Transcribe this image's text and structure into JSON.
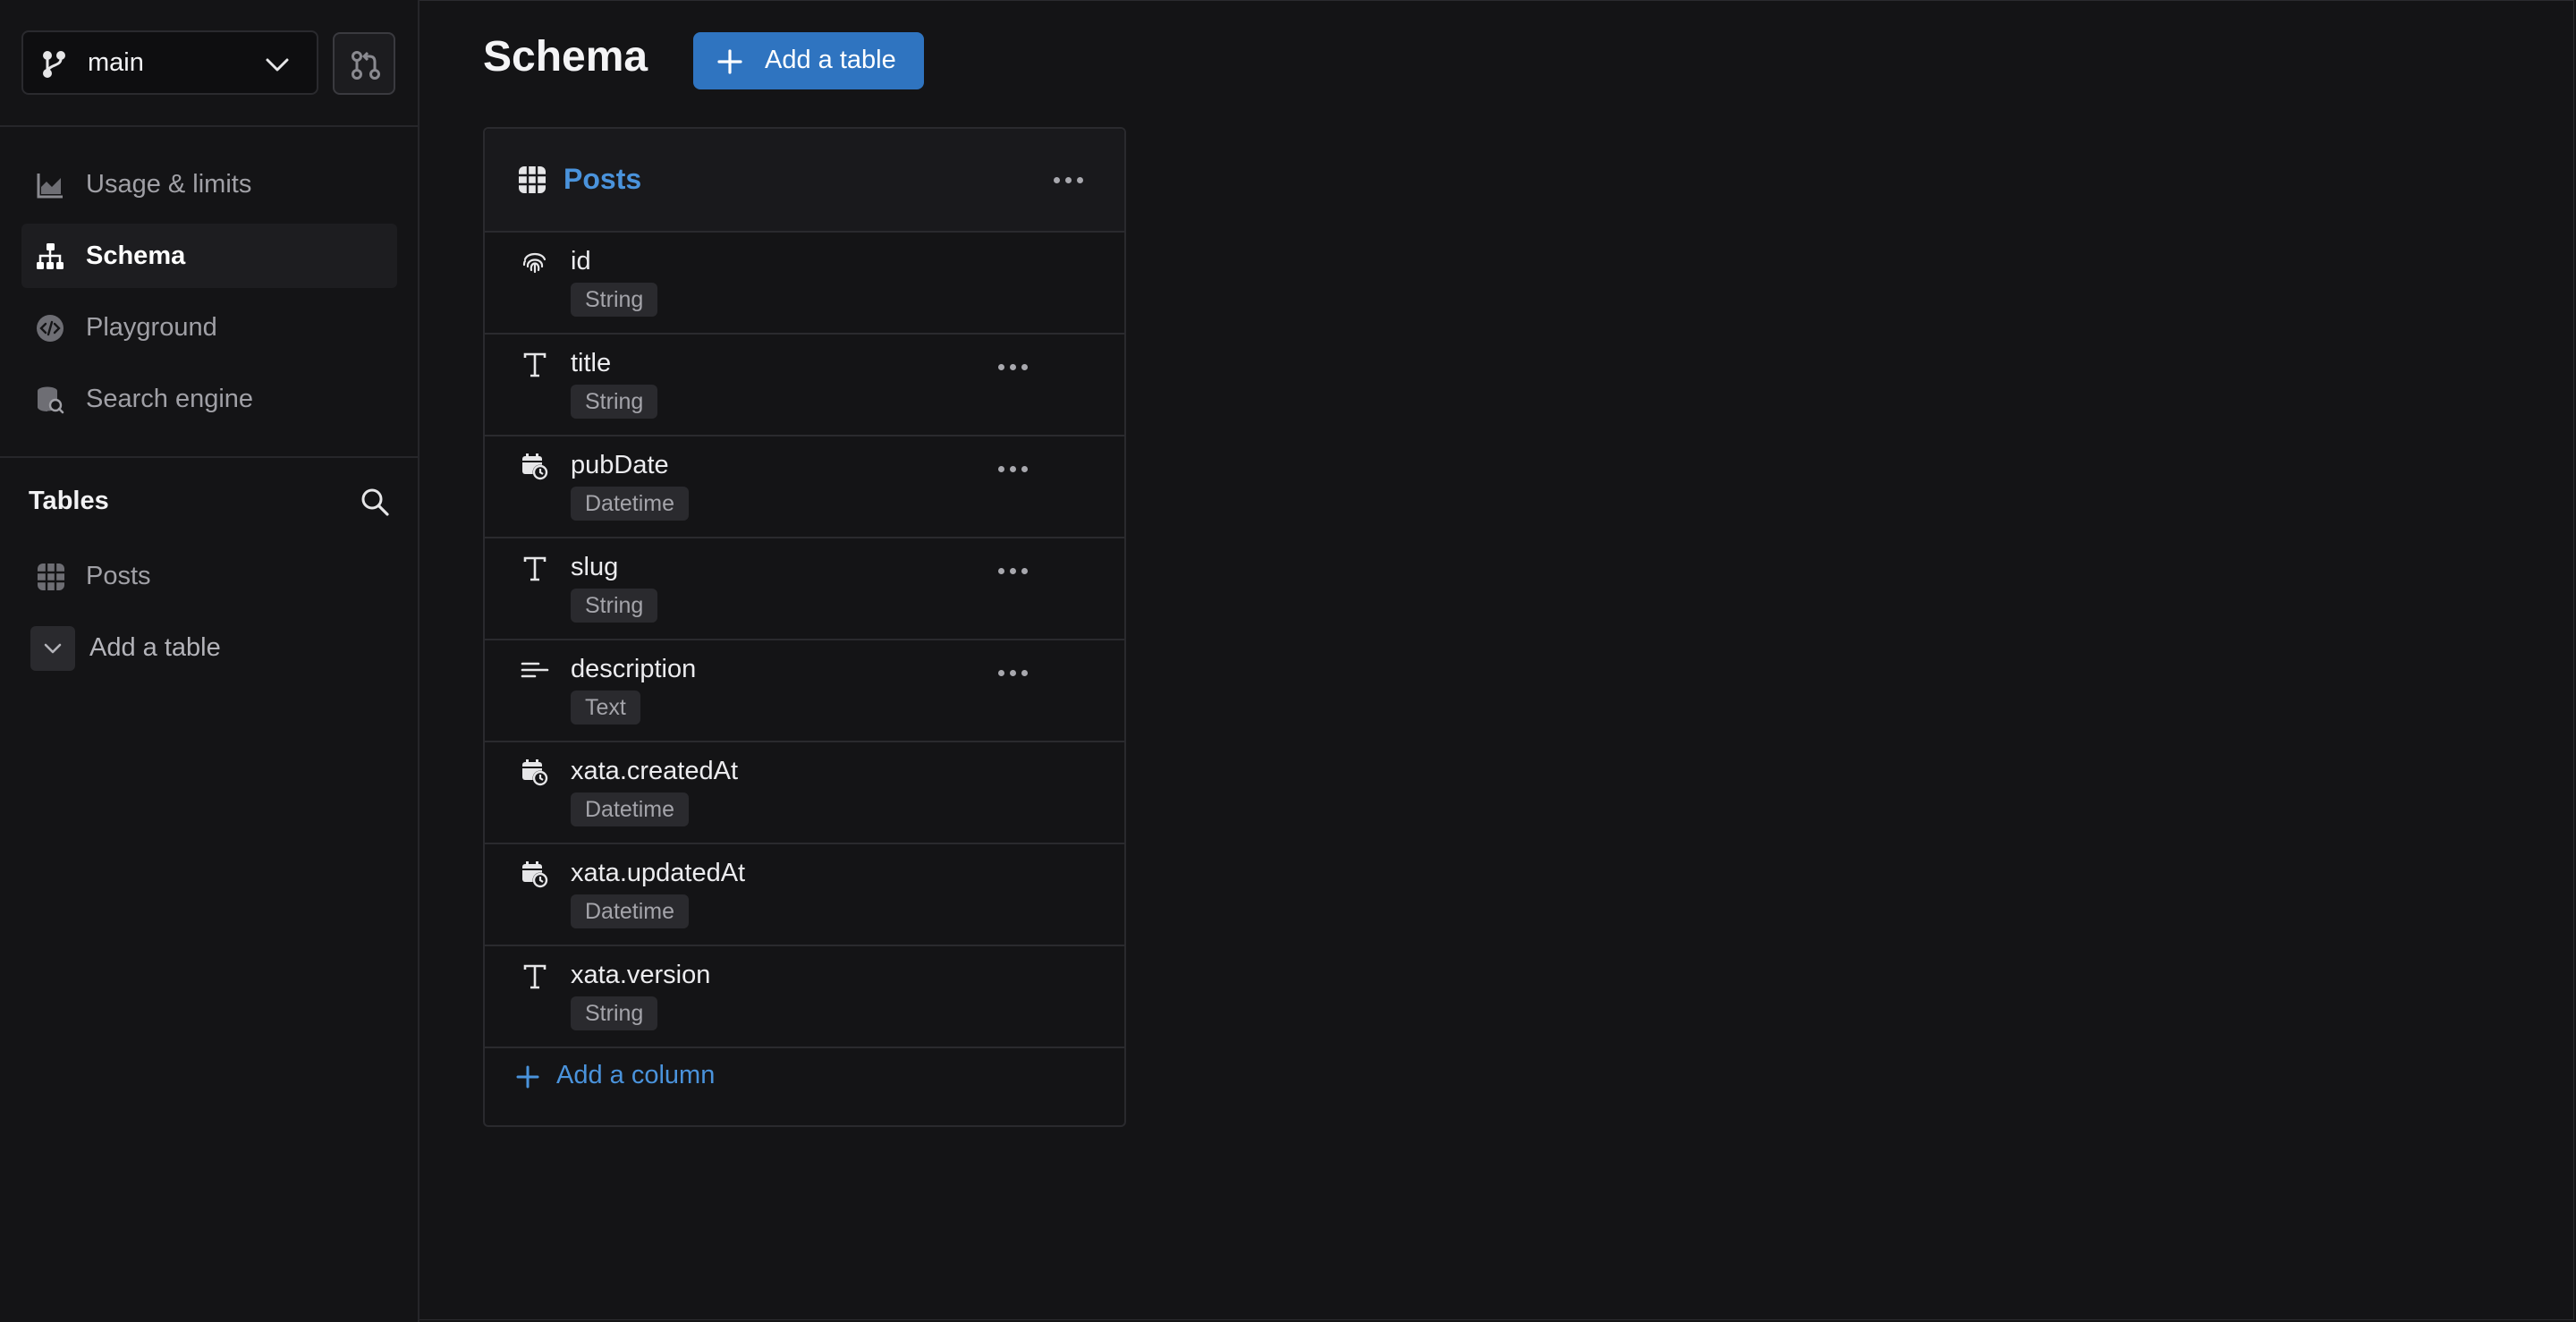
{
  "sidebar": {
    "branch": {
      "name": "main"
    },
    "nav": [
      {
        "label": "Usage & limits",
        "icon": "chart-icon",
        "active": false
      },
      {
        "label": "Schema",
        "icon": "schema-icon",
        "active": true
      },
      {
        "label": "Playground",
        "icon": "code-icon",
        "active": false
      },
      {
        "label": "Search engine",
        "icon": "database-search-icon",
        "active": false
      }
    ],
    "tables_heading": "Tables",
    "tables": [
      {
        "label": "Posts"
      }
    ],
    "add_table_label": "Add a table"
  },
  "main": {
    "title": "Schema",
    "add_table_button": "Add a table",
    "table": {
      "name": "Posts",
      "columns": [
        {
          "name": "id",
          "type": "String",
          "icon": "fingerprint-icon",
          "has_menu": false
        },
        {
          "name": "title",
          "type": "String",
          "icon": "text-icon",
          "has_menu": true
        },
        {
          "name": "pubDate",
          "type": "Datetime",
          "icon": "calendar-clock-icon",
          "has_menu": true
        },
        {
          "name": "slug",
          "type": "String",
          "icon": "text-icon",
          "has_menu": true
        },
        {
          "name": "description",
          "type": "Text",
          "icon": "paragraph-icon",
          "has_menu": true
        },
        {
          "name": "xata.createdAt",
          "type": "Datetime",
          "icon": "calendar-clock-icon",
          "has_menu": false
        },
        {
          "name": "xata.updatedAt",
          "type": "Datetime",
          "icon": "calendar-clock-icon",
          "has_menu": false
        },
        {
          "name": "xata.version",
          "type": "String",
          "icon": "text-icon",
          "has_menu": false
        }
      ],
      "add_column_label": "Add a column"
    }
  },
  "colors": {
    "accent": "#2f74c0",
    "link": "#4a93dc",
    "background": "#141416"
  }
}
